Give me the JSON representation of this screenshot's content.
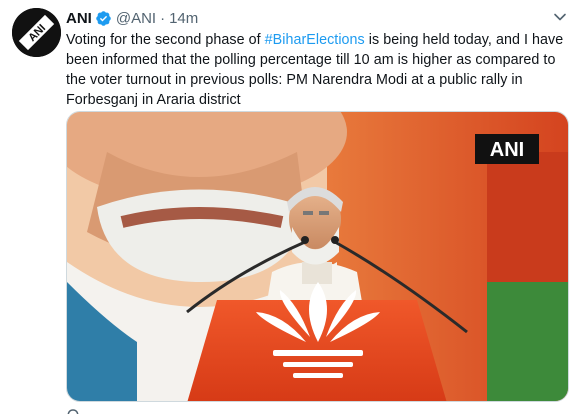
{
  "tweet": {
    "author_name": "ANI",
    "handle": "@ANI",
    "separator": "·",
    "time": "14m",
    "text_before": "Voting for the second phase of ",
    "hashtag": "#BiharElections",
    "text_after": " is being held today, and I have been informed that the polling percentage till 10 am is higher as compared to the voter turnout in previous polls: PM Narendra Modi at a public rally in Forbesganj in Araria district",
    "media_watermark": "ANI",
    "avatar_logo_text": "ANI"
  },
  "icons": {
    "verified": "verified-badge-icon",
    "more": "chevron-down-icon"
  },
  "colors": {
    "hashtag": "#1d9bf0",
    "verified": "#1d9bf0",
    "text": "#0f1419",
    "secondary": "#536471"
  }
}
